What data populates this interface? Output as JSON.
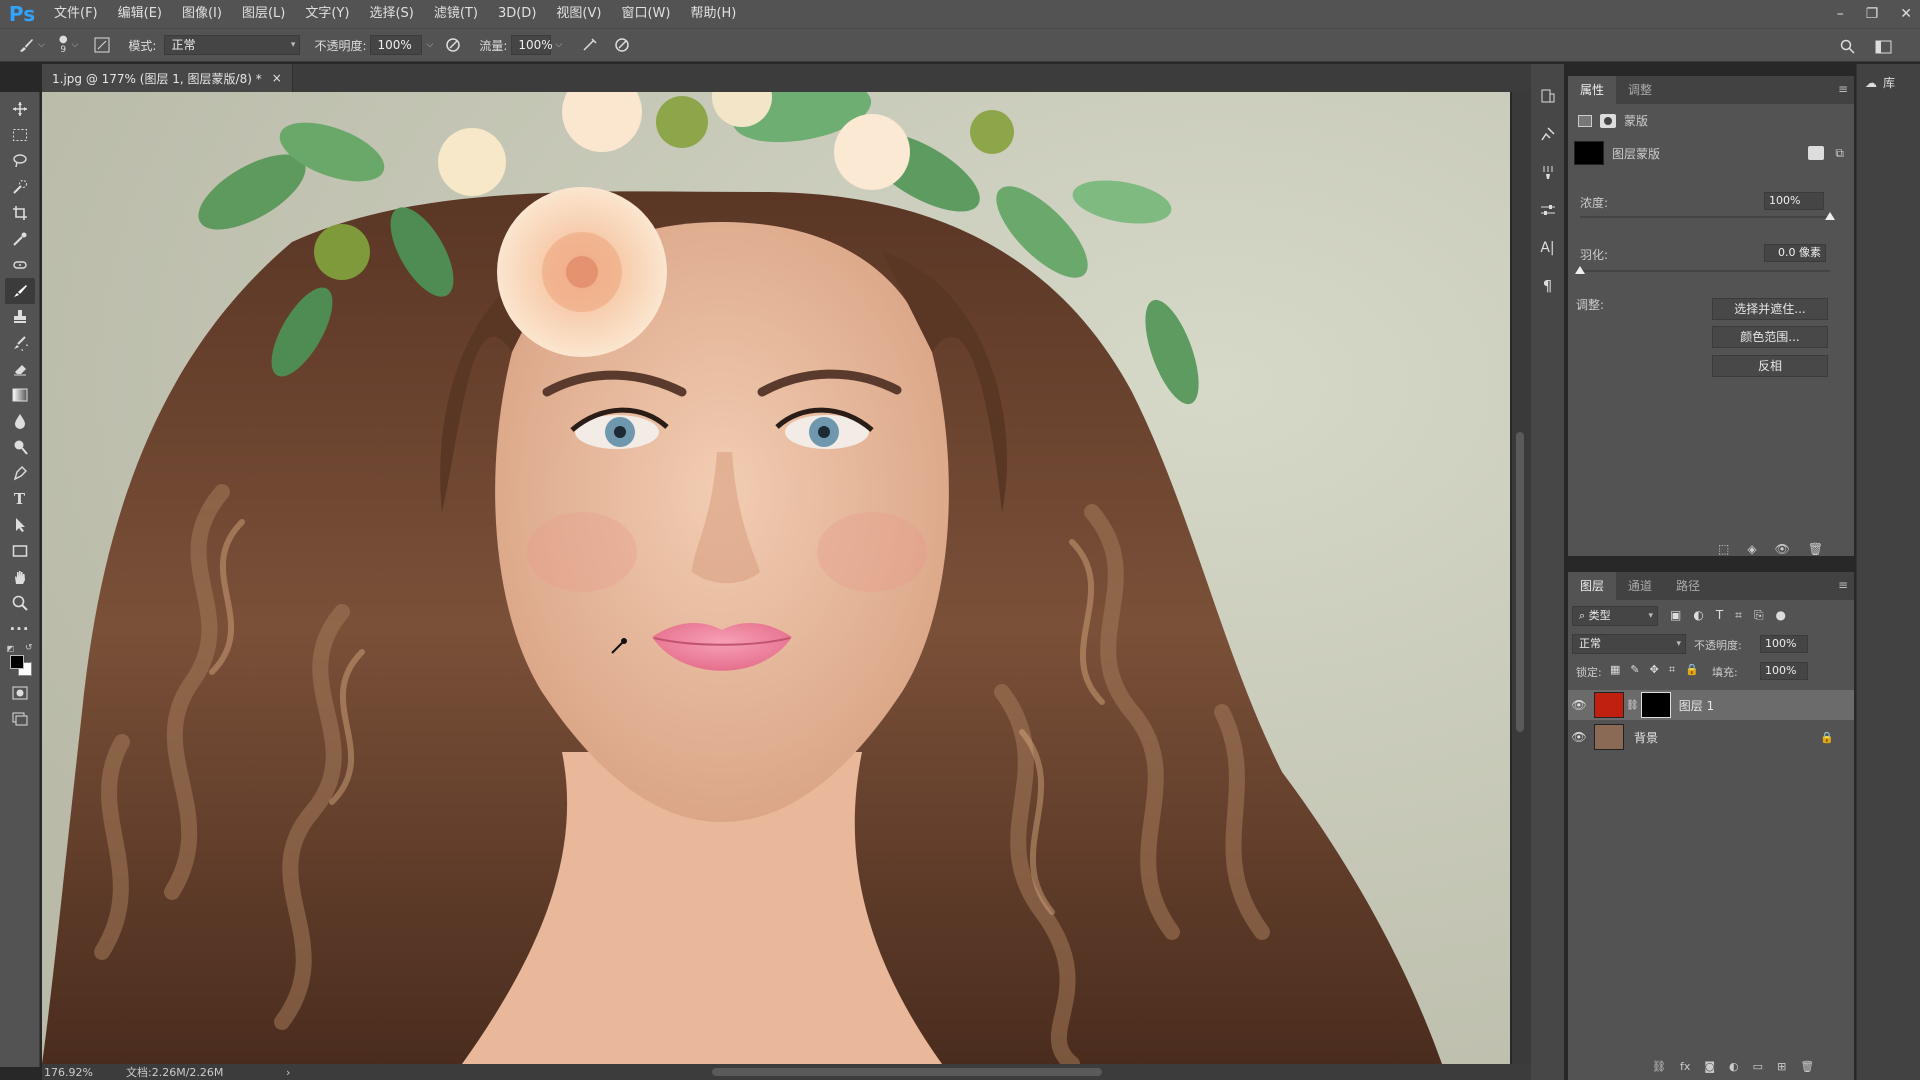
{
  "app": {
    "logo": "Ps"
  },
  "menu": [
    "文件(F)",
    "编辑(E)",
    "图像(I)",
    "图层(L)",
    "文字(Y)",
    "选择(S)",
    "滤镜(T)",
    "3D(D)",
    "视图(V)",
    "窗口(W)",
    "帮助(H)"
  ],
  "window_controls": {
    "minimize": "–",
    "restore": "❐",
    "close": "✕"
  },
  "options": {
    "brush_size": "9",
    "mode_label": "模式:",
    "mode_value": "正常",
    "opacity_label": "不透明度:",
    "opacity_value": "100%",
    "flow_label": "流量:",
    "flow_value": "100%"
  },
  "document": {
    "tab_title": "1.jpg @ 177% (图层 1, 图层蒙版/8) *",
    "close": "×"
  },
  "status": {
    "zoom": "176.92%",
    "doc_info": "文档:2.26M/2.26M",
    "arrow": "›"
  },
  "properties_panel": {
    "tabs": [
      "属性",
      "调整"
    ],
    "mask_label": "蒙版",
    "layer_mask_label": "图层蒙版",
    "density_label": "浓度:",
    "density_value": "100%",
    "density_level": 1.0,
    "feather_label": "羽化:",
    "feather_value": "0.0 像素",
    "feather_level": 0.0,
    "adjust_label": "调整:",
    "buttons": [
      "选择并遮住...",
      "颜色范围...",
      "反相"
    ]
  },
  "layers_panel": {
    "tabs": [
      "图层",
      "通道",
      "路径"
    ],
    "filter_kind": "类型",
    "blend_mode": "正常",
    "opacity_label": "不透明度:",
    "opacity_value": "100%",
    "lock_label": "锁定:",
    "fill_label": "填充:",
    "fill_value": "100%",
    "layers": [
      {
        "name": "图层 1",
        "color": "#c0200f",
        "selected": true
      },
      {
        "name": "背景",
        "color": "#8a6a55",
        "selected": false
      }
    ],
    "footer_icons": [
      "link-icon",
      "fx-icon",
      "mask-icon",
      "adjustment-icon",
      "group-icon",
      "new-layer-icon",
      "trash-icon"
    ]
  },
  "library": {
    "label": "库"
  },
  "colors": {
    "accent": "#2fa3ff",
    "layer1_fill": "#c0200f",
    "mask_fill": "#000000"
  }
}
